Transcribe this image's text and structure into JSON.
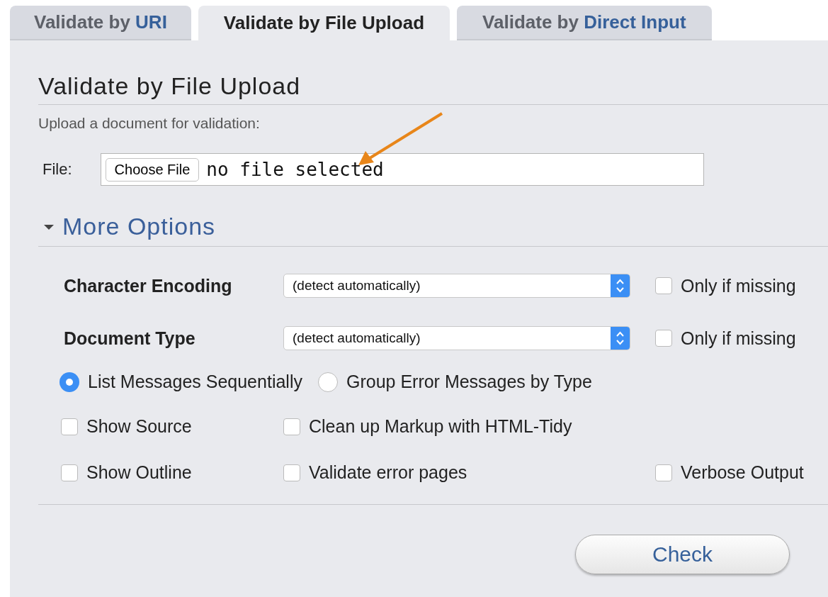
{
  "tabs": [
    {
      "lead": "Validate by",
      "name": "URI",
      "selected": false
    },
    {
      "lead": "Validate by",
      "name": "File Upload",
      "selected": true
    },
    {
      "lead": "Validate by",
      "name": "Direct Input",
      "selected": false
    }
  ],
  "panel": {
    "title": "Validate by File Upload",
    "instruction": "Upload a document for validation:",
    "file": {
      "label": "File:",
      "button": "Choose File",
      "status": "no file selected"
    },
    "more_options": {
      "label": "More Options",
      "expanded": true
    },
    "selects": [
      {
        "label": "Character Encoding",
        "value": "(detect automatically)",
        "only_if_missing": {
          "label": "Only if missing",
          "checked": false
        }
      },
      {
        "label": "Document Type",
        "value": "(detect automatically)",
        "only_if_missing": {
          "label": "Only if missing",
          "checked": false
        }
      }
    ],
    "message_modes": [
      {
        "label": "List Messages Sequentially",
        "selected": true
      },
      {
        "label": "Group Error Messages by Type",
        "selected": false
      }
    ],
    "option_rows": [
      [
        {
          "label": "Show Source",
          "checked": false
        },
        {
          "label": "Clean up Markup with HTML-Tidy",
          "checked": false
        }
      ],
      [
        {
          "label": "Show Outline",
          "checked": false
        },
        {
          "label": "Validate error pages",
          "checked": false
        },
        {
          "label": "Verbose Output",
          "checked": false
        }
      ]
    ],
    "submit": "Check"
  }
}
